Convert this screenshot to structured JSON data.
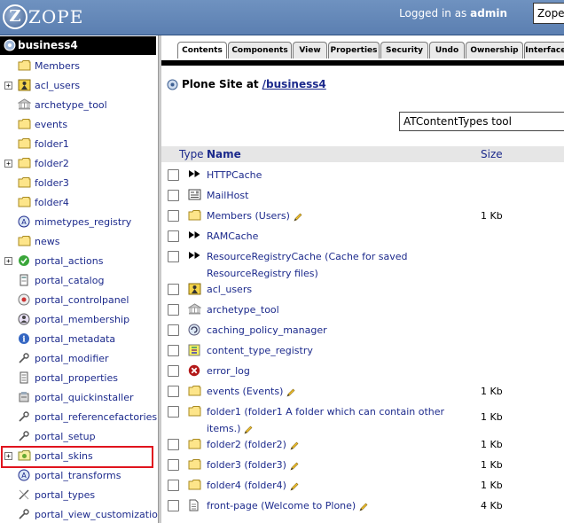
{
  "topbar": {
    "logo_letter": "Z",
    "logo_text": "ZOPE",
    "logged_in_prefix": "Logged in as",
    "username": "admin",
    "view_select": "Zope"
  },
  "tree": {
    "root": "business4",
    "items": [
      {
        "label": "Members",
        "icon": "folder-icon",
        "expand": false
      },
      {
        "label": "acl_users",
        "icon": "user-folder-icon",
        "expand": true
      },
      {
        "label": "archetype_tool",
        "icon": "archetype-tool-icon",
        "expand": false
      },
      {
        "label": "events",
        "icon": "folder-icon",
        "expand": false
      },
      {
        "label": "folder1",
        "icon": "folder-icon",
        "expand": false
      },
      {
        "label": "folder2",
        "icon": "folder-icon",
        "expand": true
      },
      {
        "label": "folder3",
        "icon": "folder-icon",
        "expand": false
      },
      {
        "label": "folder4",
        "icon": "folder-icon",
        "expand": false
      },
      {
        "label": "mimetypes_registry",
        "icon": "mimetypes-icon",
        "expand": false
      },
      {
        "label": "news",
        "icon": "folder-icon",
        "expand": false
      },
      {
        "label": "portal_actions",
        "icon": "actions-icon",
        "expand": true
      },
      {
        "label": "portal_catalog",
        "icon": "catalog-icon",
        "expand": false
      },
      {
        "label": "portal_controlpanel",
        "icon": "controlpanel-icon",
        "expand": false
      },
      {
        "label": "portal_membership",
        "icon": "membership-icon",
        "expand": false
      },
      {
        "label": "portal_metadata",
        "icon": "info-icon",
        "expand": false
      },
      {
        "label": "portal_modifier",
        "icon": "wrench-icon",
        "expand": false
      },
      {
        "label": "portal_properties",
        "icon": "properties-icon",
        "expand": false
      },
      {
        "label": "portal_quickinstaller",
        "icon": "quickinstaller-icon",
        "expand": false
      },
      {
        "label": "portal_referencefactories",
        "icon": "wrench-icon",
        "expand": false
      },
      {
        "label": "portal_setup",
        "icon": "wrench-icon",
        "expand": false
      },
      {
        "label": "portal_skins",
        "icon": "skins-icon",
        "expand": true
      },
      {
        "label": "portal_transforms",
        "icon": "transforms-icon",
        "expand": false
      },
      {
        "label": "portal_types",
        "icon": "types-icon",
        "expand": false
      },
      {
        "label": "portal_view_customizations",
        "icon": "wrench-icon",
        "expand": false
      }
    ]
  },
  "tabs": [
    "Contents",
    "Components",
    "View",
    "Properties",
    "Security",
    "Undo",
    "Ownership",
    "Interfaces"
  ],
  "active_tab": "Contents",
  "header": {
    "prefix": "Plone Site at",
    "path": "/business4"
  },
  "add_select": "ATContentTypes tool",
  "columns": {
    "type": "Type",
    "name": "Name",
    "size": "Size"
  },
  "rows": [
    {
      "name": "HTTPCache",
      "icon": "cache-icon",
      "size": "",
      "edit": false,
      "tall": false
    },
    {
      "name": "MailHost",
      "icon": "mailhost-icon",
      "size": "",
      "edit": false,
      "tall": false
    },
    {
      "name": "Members (Users)",
      "icon": "folder-icon",
      "size": "1 Kb",
      "edit": true,
      "tall": false
    },
    {
      "name": "RAMCache",
      "icon": "cache-icon",
      "size": "",
      "edit": false,
      "tall": false
    },
    {
      "name": "ResourceRegistryCache (Cache for saved ResourceRegistry files)",
      "icon": "cache-icon",
      "size": "",
      "edit": false,
      "tall": true
    },
    {
      "name": "acl_users",
      "icon": "user-folder-icon",
      "size": "",
      "edit": false,
      "tall": false
    },
    {
      "name": "archetype_tool",
      "icon": "archetype-tool-icon",
      "size": "",
      "edit": false,
      "tall": false
    },
    {
      "name": "caching_policy_manager",
      "icon": "policy-icon",
      "size": "",
      "edit": false,
      "tall": false
    },
    {
      "name": "content_type_registry",
      "icon": "registry-icon",
      "size": "",
      "edit": false,
      "tall": false
    },
    {
      "name": "error_log",
      "icon": "error-icon",
      "size": "",
      "edit": false,
      "tall": false
    },
    {
      "name": "events (Events)",
      "icon": "folder-icon",
      "size": "1 Kb",
      "edit": true,
      "tall": false
    },
    {
      "name": "folder1 (folder1 A folder which can contain other items.)",
      "icon": "folder-icon",
      "size": "1 Kb",
      "edit": true,
      "tall": true
    },
    {
      "name": "folder2 (folder2)",
      "icon": "folder-icon",
      "size": "1 Kb",
      "edit": true,
      "tall": false
    },
    {
      "name": "folder3 (folder3)",
      "icon": "folder-icon",
      "size": "1 Kb",
      "edit": true,
      "tall": false
    },
    {
      "name": "folder4 (folder4)",
      "icon": "folder-icon",
      "size": "1 Kb",
      "edit": true,
      "tall": false
    },
    {
      "name": "front-page (Welcome to Plone)",
      "icon": "document-icon",
      "size": "4 Kb",
      "edit": true,
      "tall": false
    }
  ]
}
